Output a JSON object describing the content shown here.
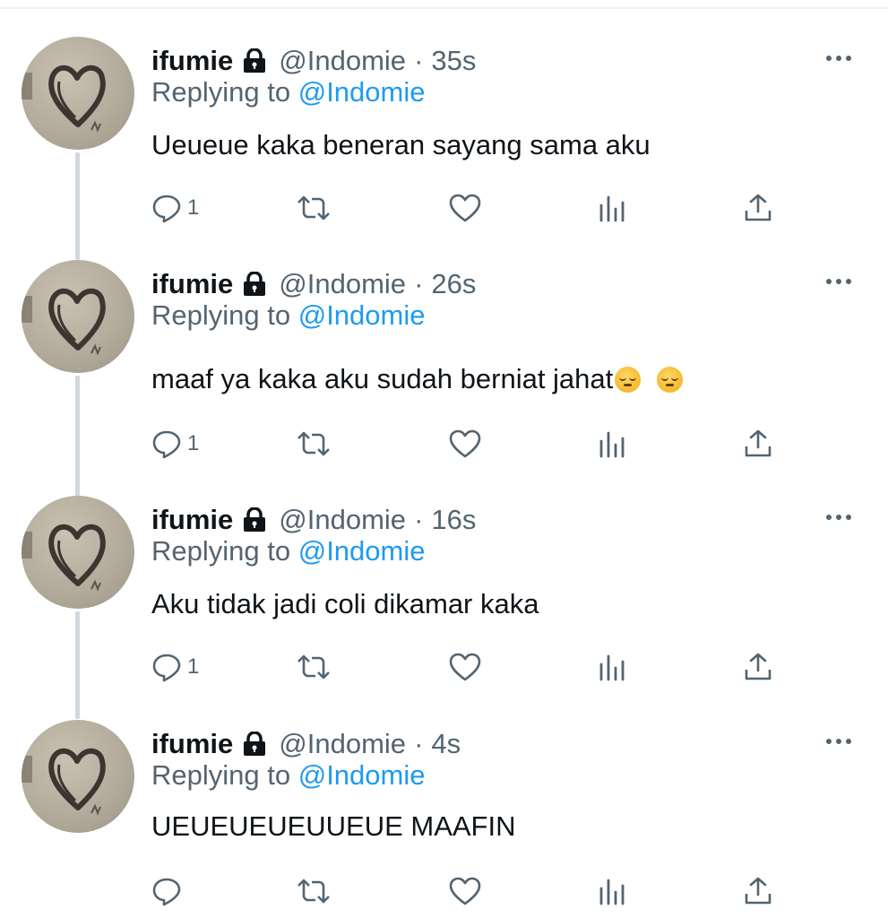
{
  "tweets": [
    {
      "name": "ifumie",
      "handle": "@Indomie",
      "separator": "·",
      "time": "35s",
      "replying_prefix": "Replying to",
      "replying_to": "@Indomie",
      "text": "Ueueue kaka beneran sayang sama aku",
      "reply_count": "1"
    },
    {
      "name": "ifumie",
      "handle": "@Indomie",
      "separator": "·",
      "time": "26s",
      "replying_prefix": "Replying to",
      "replying_to": "@Indomie",
      "text": "maaf ya kaka aku sudah berniat jahat",
      "reply_count": "1"
    },
    {
      "name": "ifumie",
      "handle": "@Indomie",
      "separator": "·",
      "time": "16s",
      "replying_prefix": "Replying to",
      "replying_to": "@Indomie",
      "text": "Aku tidak jadi coli dikamar kaka",
      "reply_count": "1"
    },
    {
      "name": "ifumie",
      "handle": "@Indomie",
      "separator": "·",
      "time": "4s",
      "replying_prefix": "Replying to",
      "replying_to": "@Indomie",
      "text": "UEUEUEUEUUEUE MAAFIN",
      "reply_count": ""
    }
  ],
  "icons": {
    "lock": "lock-icon",
    "more": "more-icon",
    "reply": "reply-icon",
    "retweet": "retweet-icon",
    "like": "heart-icon",
    "views": "analytics-icon",
    "share": "share-icon",
    "emoji": "pensive-face-emoji"
  },
  "colors": {
    "text": "#0f1419",
    "secondary": "#536471",
    "link": "#1d9bf0",
    "thread_line": "#cfd9de"
  }
}
